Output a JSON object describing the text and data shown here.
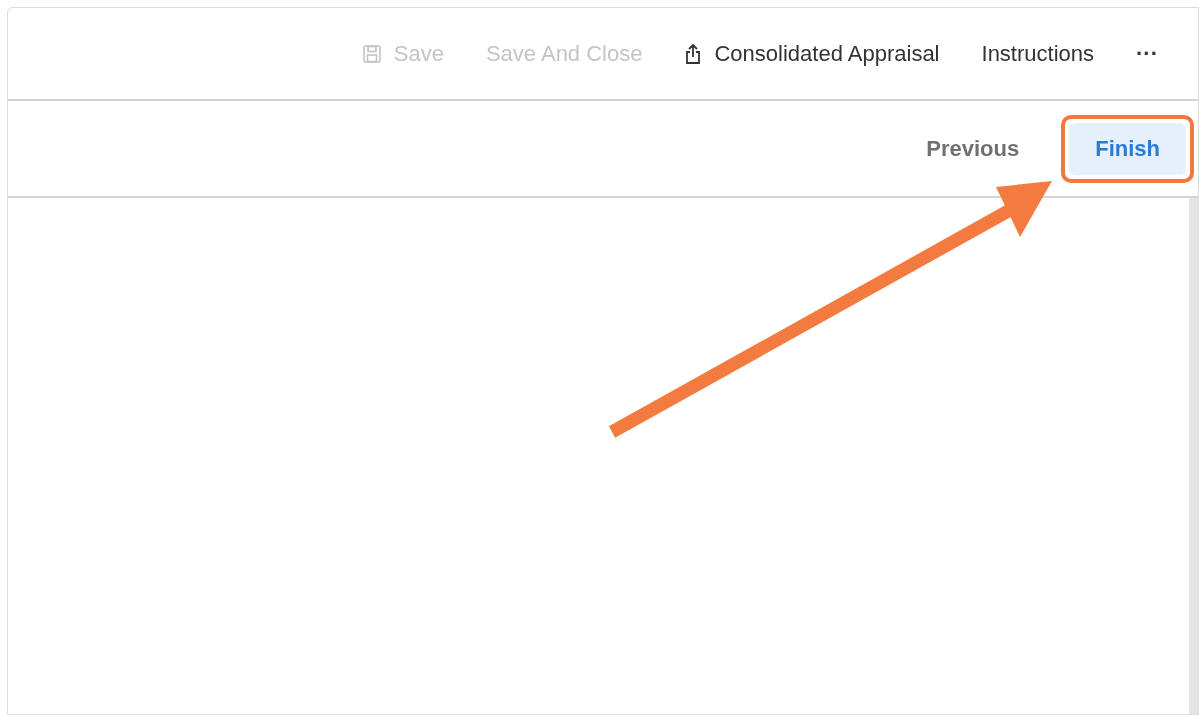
{
  "toolbar": {
    "actions": [
      {
        "label": "Save",
        "kind": "save",
        "disabled": true
      },
      {
        "label": "Save And Close",
        "kind": "plain",
        "disabled": true
      },
      {
        "label": "Consolidated Appraisal",
        "kind": "share",
        "disabled": false
      },
      {
        "label": "Instructions",
        "kind": "plain",
        "disabled": false
      },
      {
        "label": "···",
        "kind": "more",
        "disabled": false
      }
    ]
  },
  "navigation": {
    "buttons": [
      {
        "label": "Previous",
        "selected": false,
        "highlighted": false
      },
      {
        "label": "Finish",
        "selected": true,
        "highlighted": true
      }
    ]
  }
}
